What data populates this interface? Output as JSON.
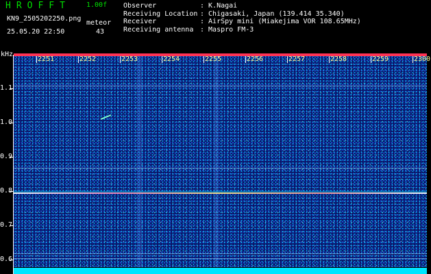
{
  "header": {
    "app_name": "HROFFT",
    "version": "1.00f",
    "file_name": "KN9_2505202250.png",
    "meteor_label": "meteor",
    "timestamp": "25.05.20 22:50",
    "meteor_count": "43",
    "unit": "kHz"
  },
  "info_rows": [
    {
      "key": "Observer",
      "value": ": K.Nagai"
    },
    {
      "key": "Receiving Location",
      "value": ": Chigasaki, Japan (139.414 35.340)"
    },
    {
      "key": "Receiver",
      "value": ": AirSpy mini (Miakejima VOR 108.65MHz)"
    },
    {
      "key": "Receiving antenna",
      "value": ": Maspro FM-3"
    }
  ],
  "time_axis": {
    "labels": [
      "2251",
      "2252",
      "2253",
      "2254",
      "2255",
      "2256",
      "2257",
      "2258",
      "2259",
      "2300"
    ]
  },
  "freq_axis": {
    "labels": [
      "1.1",
      "1.0",
      "0.9",
      "0.8",
      "0.7",
      "0.6"
    ],
    "values": [
      1.1,
      1.0,
      0.9,
      0.8,
      0.7,
      0.6
    ]
  },
  "colors": {
    "background": "#10208a",
    "app_name": "#00e000",
    "trace": "#ff7fb0",
    "footer": "#00e5ff"
  }
}
